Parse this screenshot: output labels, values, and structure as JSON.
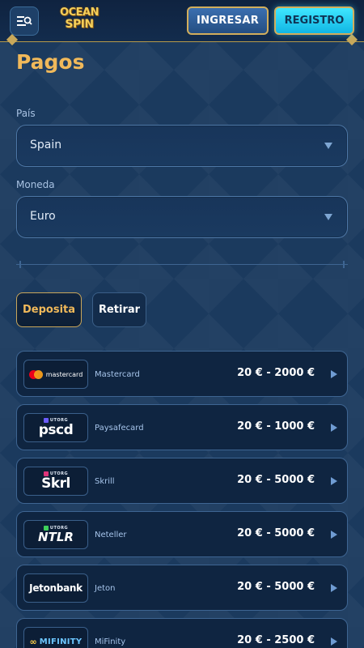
{
  "header": {
    "logo_line1": "OCEAN",
    "logo_line2": "SPIN",
    "login_label": "INGRESAR",
    "register_label": "REGISTRO"
  },
  "page": {
    "title": "Pagos",
    "country_label": "País",
    "country_value": "Spain",
    "currency_label": "Moneda",
    "currency_value": "Euro",
    "tab_deposit": "Deposita",
    "tab_withdraw": "Retirar"
  },
  "colors": {
    "accent_gold": "#f1b95a",
    "register_cyan": "#3fe7ff",
    "background": "#1b3a5e"
  },
  "payments": [
    {
      "name": "Mastercard",
      "logo_text": "mastercard",
      "range": "20 € - 2000 €",
      "icon": "mastercard-logo"
    },
    {
      "name": "Paysafecard",
      "logo_tag": "UTORG",
      "logo_text": "pscd",
      "range": "20 € - 1000 €",
      "icon": "paysafecard-logo"
    },
    {
      "name": "Skrill",
      "logo_tag": "UTORG",
      "logo_text": "Skrl",
      "range": "20 € - 5000 €",
      "icon": "skrill-logo"
    },
    {
      "name": "Neteller",
      "logo_tag": "UTORG",
      "logo_text": "NTLR",
      "range": "20 € - 5000 €",
      "icon": "neteller-logo"
    },
    {
      "name": "Jeton",
      "logo_text": "Jetonbank",
      "range": "20 € - 5000 €",
      "icon": "jetonbank-logo"
    },
    {
      "name": "MiFinity",
      "logo_text": "MIFINITY",
      "range": "20 € - 2500 €",
      "icon": "mifinity-logo"
    }
  ]
}
